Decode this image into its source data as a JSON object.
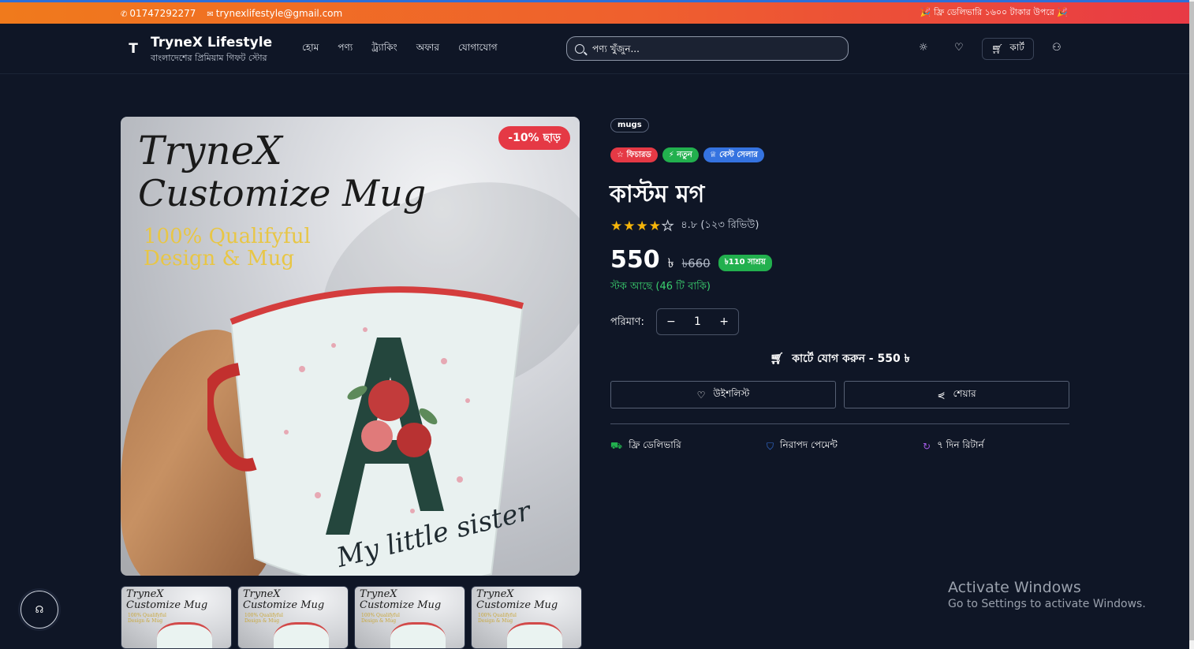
{
  "topbar": {
    "phone": "01747292277",
    "email": "trynexlifestyle@gmail.com",
    "promo": "🎉 ফ্রি ডেলিভারি ১৬০০ টাকার উপরে 🎉"
  },
  "header": {
    "logo_mark": "T",
    "brand": "TryneX Lifestyle",
    "tagline": "বাংলাদেশের প্রিমিয়াম গিফট স্টোর",
    "nav": [
      "হোম",
      "পণ্য",
      "ট্র্যাকিং",
      "অফার",
      "যোগাযোগ"
    ],
    "search_placeholder": "পণ্য খুঁজুন...",
    "cart_label": "কার্ট"
  },
  "product": {
    "image_text": {
      "line1": "TryneX",
      "line2": "Customize Mug",
      "line3": "100% Qualifyful",
      "line4": "Design & Mug",
      "mug_caption": "My little sister"
    },
    "discount_badge": "-10% ছাড়",
    "thumbnails": [
      {
        "t1": "TryneX",
        "t2": "Customize Mug",
        "t3": "100% Qualifyful",
        "t4": "Design & Mug"
      },
      {
        "t1": "TryneX",
        "t2": "Customize Mug",
        "t3": "100% Qualifyful",
        "t4": "Design & Mug"
      },
      {
        "t1": "TryneX",
        "t2": "Customize Mug",
        "t3": "100% Qualifyful",
        "t4": "Design & Mug"
      },
      {
        "t1": "TryneX",
        "t2": "Customize Mug",
        "t3": "100% Qualifyful",
        "t4": "Design & Mug"
      }
    ],
    "category": "mugs",
    "badges": [
      {
        "label": "☆ ফিচারড",
        "color": "#e53945"
      },
      {
        "label": "⚡ নতুন",
        "color": "#22b04e"
      },
      {
        "label": "♕ বেস্ট সেলার",
        "color": "#3573e0"
      }
    ],
    "title": "কাস্টম মগ",
    "rating_value": 4,
    "rating_max": 5,
    "rating_text": "৪.৮ (১২৩ রিভিউ)",
    "price": "550",
    "currency": "৳",
    "old_price": "৳660",
    "save_text": "৳110 সাশ্রয়",
    "stock_text": "স্টক আছে (46 টি বাকি)",
    "qty_label": "পরিমাণ:",
    "qty_value": "1",
    "add_to_cart": "কার্টে যোগ করুন - 550 ৳",
    "wishlist_label": "উইশলিস্ট",
    "share_label": "শেয়ার",
    "features": [
      {
        "label": "ফ্রি ডেলিভারি",
        "icon": "truck-icon",
        "color": "#22b04e"
      },
      {
        "label": "নিরাপদ পেমেন্ট",
        "icon": "shield-icon",
        "color": "#3573e0"
      },
      {
        "label": "৭ দিন রিটার্ন",
        "icon": "refresh-icon",
        "color": "#a35be6"
      }
    ]
  },
  "watermark": {
    "line1": "Activate Windows",
    "line2": "Go to Settings to activate Windows."
  }
}
